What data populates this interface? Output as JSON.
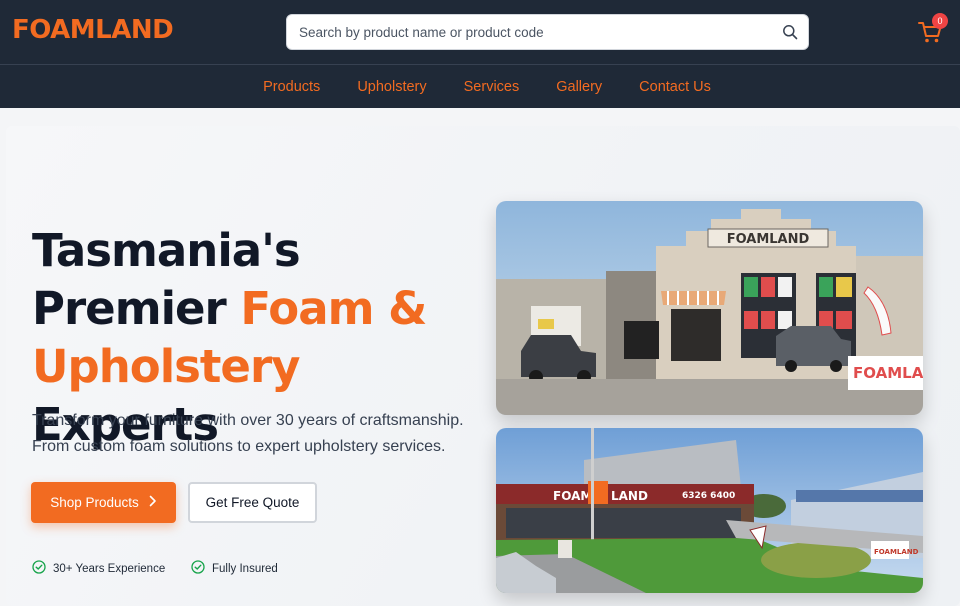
{
  "header": {
    "logo": "FOAMLAND",
    "search_placeholder": "Search by product name or product code",
    "search_icon": "search-icon",
    "cart_icon": "shopping-cart-icon",
    "cart_count": "0"
  },
  "nav": {
    "items": [
      {
        "label": "Products"
      },
      {
        "label": "Upholstery"
      },
      {
        "label": "Services"
      },
      {
        "label": "Gallery"
      },
      {
        "label": "Contact Us"
      }
    ]
  },
  "hero": {
    "headline_1": "Tasmania's",
    "headline_2": "Premier ",
    "headline_2_accent": "Foam &",
    "headline_3_accent": "Upholstery",
    "headline_3": " Experts",
    "subtext_1": "Transform your furniture with over 30 years of craftsmanship.",
    "subtext_2": "From custom foam solutions to expert upholstery services.",
    "primary_button": "Shop Products",
    "secondary_button": "Get Free Quote",
    "features": [
      {
        "label": "30+ Years Experience",
        "icon": "check-circle-icon"
      },
      {
        "label": "Fully Insured",
        "icon": "check-circle-icon"
      }
    ]
  },
  "photos": {
    "store_1_sign": "FOAMLAND",
    "store_1_banner": "FOAMLA",
    "store_2_sign_left": "FOAM",
    "store_2_sign_right": "LAND",
    "store_2_phone": "6326 6400",
    "store_2_flag": "FOAMLAND"
  },
  "colors": {
    "brand_orange": "#f26b21",
    "header_bg": "#1f2937",
    "badge_red": "#ef4444",
    "check_green": "#16a34a"
  }
}
